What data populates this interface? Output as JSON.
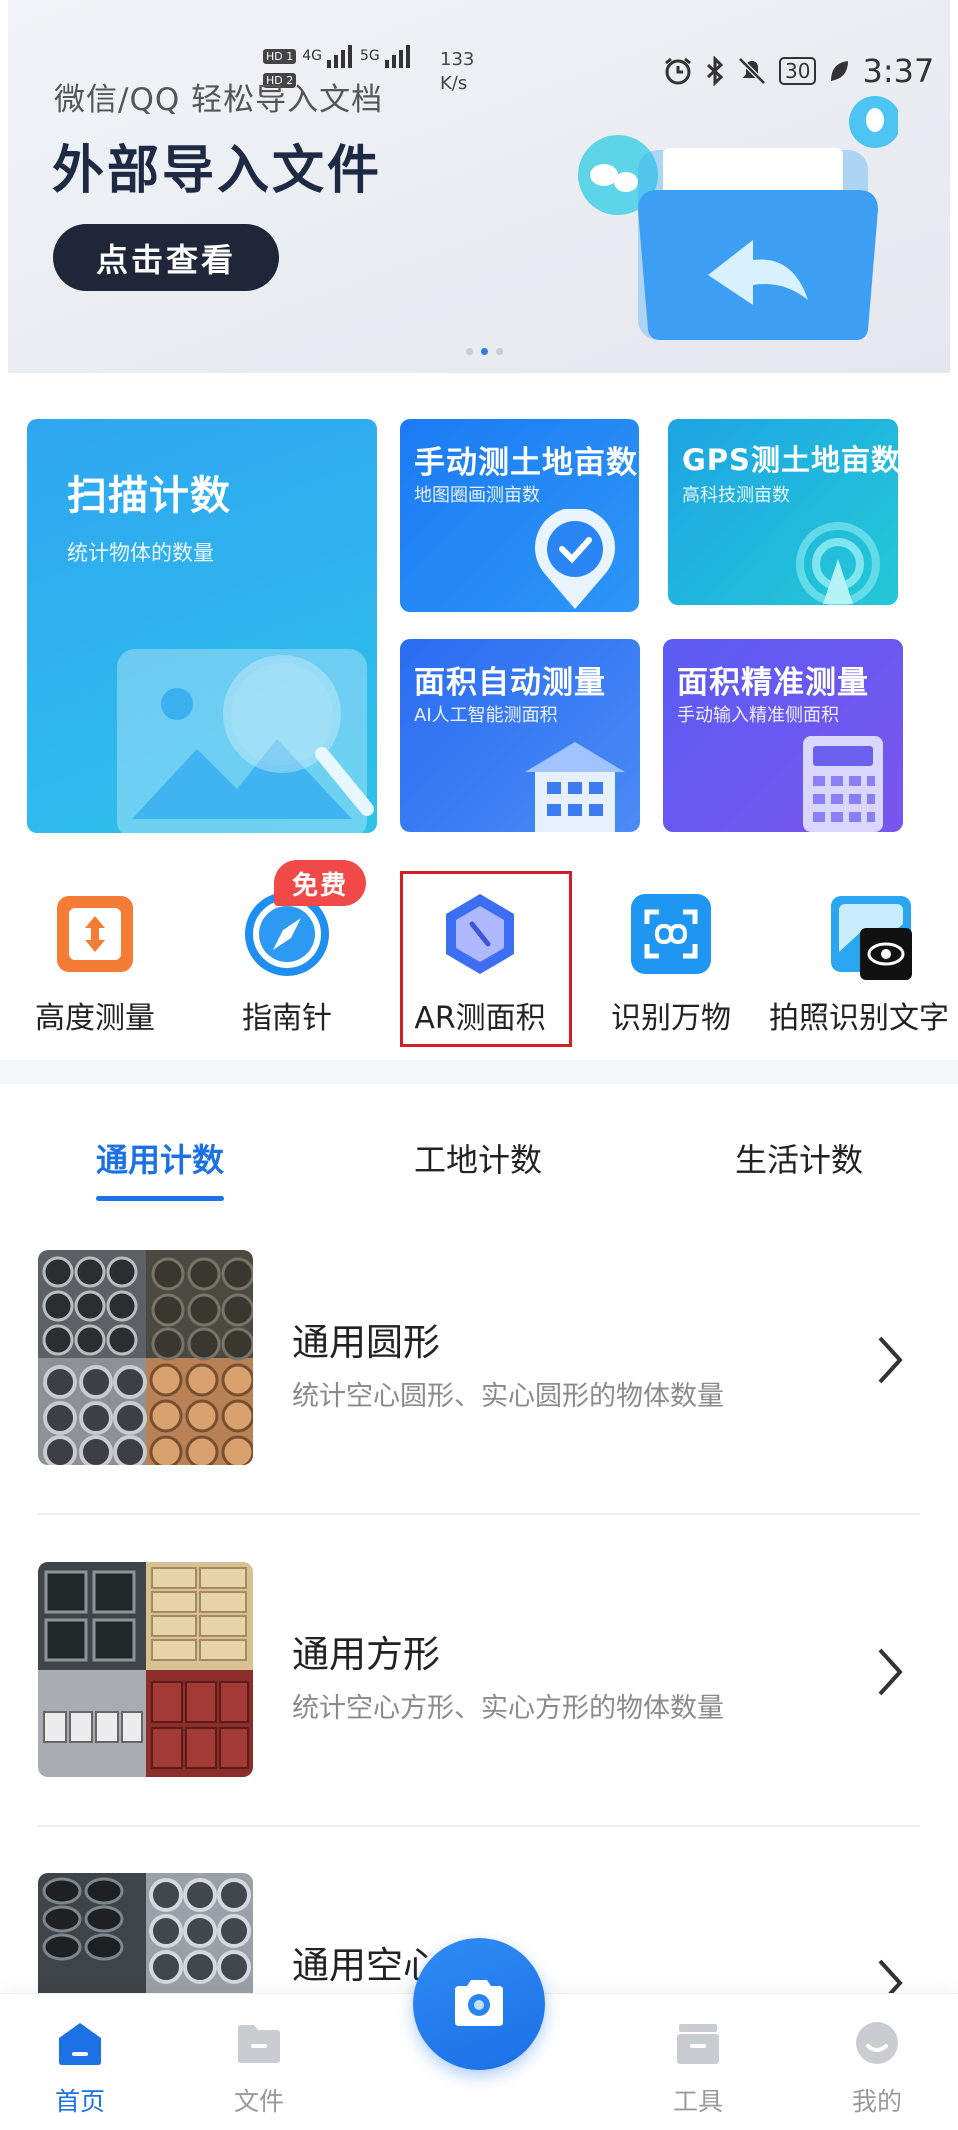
{
  "status_bar": {
    "sim1": "HD 1",
    "sim2": "HD 2",
    "net1": "4G",
    "net2": "5G",
    "speed_value": "133",
    "speed_unit": "K/s",
    "battery": "30",
    "time": "3:37"
  },
  "banner": {
    "subtitle": "微信/QQ 轻松导入文档",
    "title": "外部导入文件",
    "button": "点击查看",
    "page_index": 2,
    "page_count": 3
  },
  "features": {
    "scan": {
      "title": "扫描计数",
      "subtitle": "统计物体的数量"
    },
    "manual": {
      "title": "手动测土地亩数",
      "subtitle": "地图圈画测亩数"
    },
    "gps": {
      "title": "GPS测土地亩数",
      "subtitle": "高科技测亩数"
    },
    "auto": {
      "title": "面积自动测量",
      "subtitle": "AI人工智能测面积"
    },
    "precise": {
      "title": "面积精准测量",
      "subtitle": "手动输入精准侧面积"
    }
  },
  "tools": {
    "badge": "免费",
    "items": [
      {
        "label": "高度测量"
      },
      {
        "label": "指南针"
      },
      {
        "label": "AR测面积"
      },
      {
        "label": "识别万物"
      },
      {
        "label": "拍照识别文字"
      }
    ]
  },
  "tabs": {
    "general": "通用计数",
    "site": "工地计数",
    "life": "生活计数",
    "active": "通用计数"
  },
  "list": [
    {
      "title": "通用圆形",
      "desc": "统计空心圆形、实心圆形的物体数量"
    },
    {
      "title": "通用方形",
      "desc": "统计空心方形、实心方形的物体数量"
    },
    {
      "title": "通用空心",
      "desc": ""
    }
  ],
  "nav": {
    "home": "首页",
    "files": "文件",
    "tools": "工具",
    "mine": "我的"
  },
  "colors": {
    "accent": "#1c71e4",
    "badge": "#f1484a",
    "highlight_box": "#d01f25"
  }
}
